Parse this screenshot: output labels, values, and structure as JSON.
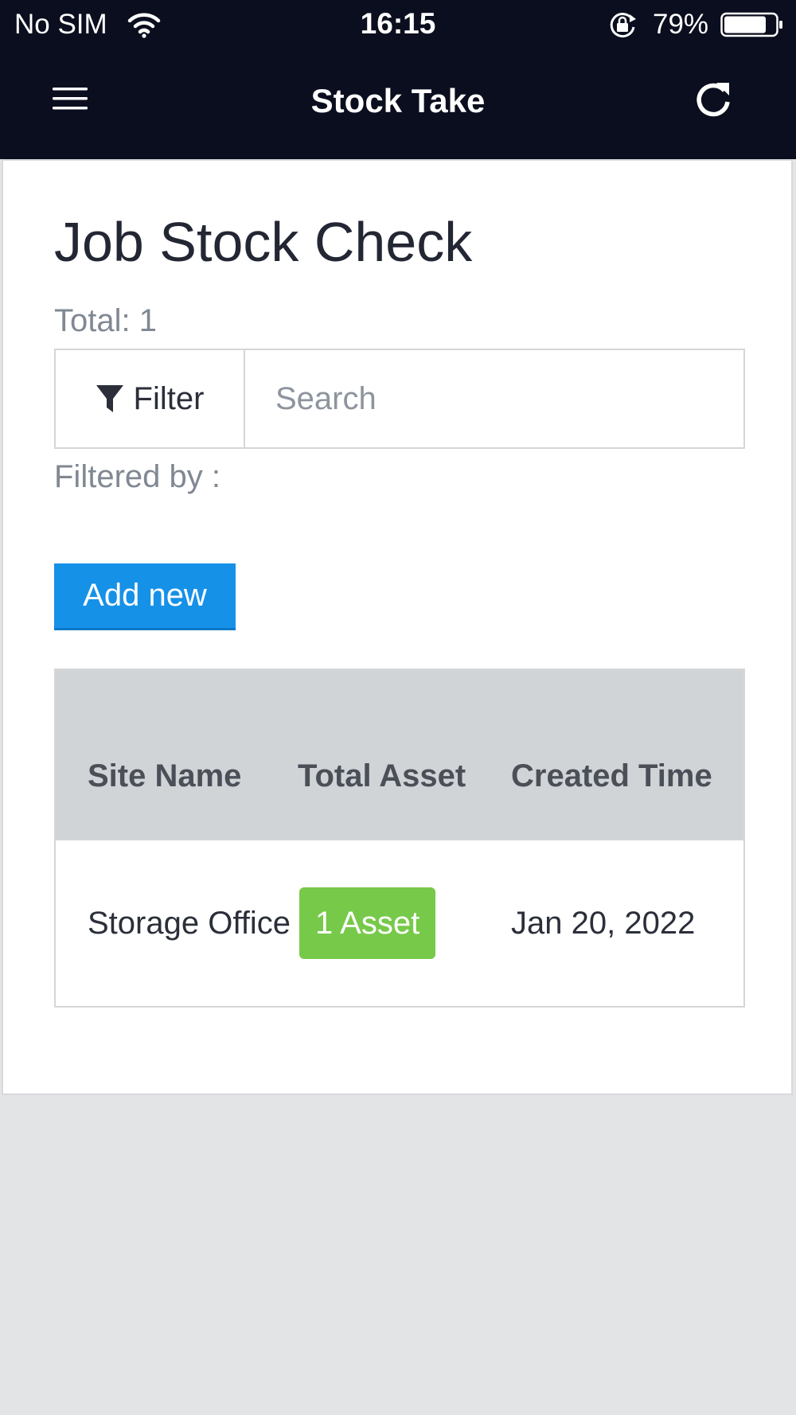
{
  "status_bar": {
    "carrier": "No SIM",
    "time": "16:15",
    "battery_percent": "79%"
  },
  "nav": {
    "title": "Stock Take",
    "menu_icon": "hamburger-menu-icon",
    "refresh_icon": "refresh-icon"
  },
  "page": {
    "title": "Job Stock Check",
    "total_label": "Total: 1",
    "filter_label": "Filter",
    "search_placeholder": "Search",
    "search_value": "",
    "filtered_by_label": "Filtered by :",
    "add_button_label": "Add new"
  },
  "table": {
    "headers": {
      "site_name": "Site Name",
      "total_asset": "Total Asset",
      "created_time": "Created Time"
    },
    "rows": [
      {
        "site_name": "Storage Office",
        "total_asset": "1 Asset",
        "created_time": "Jan 20, 2022"
      }
    ]
  },
  "colors": {
    "nav_background": "#0b0e1e",
    "primary_button": "#1591e8",
    "asset_badge": "#77c94a",
    "table_header_bg": "#d1d4d7"
  }
}
